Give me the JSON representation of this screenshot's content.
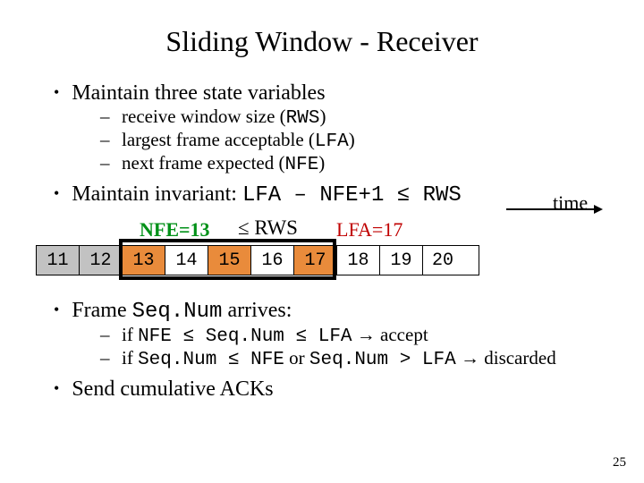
{
  "title": "Sliding Window - Receiver",
  "b1": "Maintain three state variables",
  "s1a_pre": "receive window size (",
  "s1a_code": "RWS",
  "s1a_post": ")",
  "s1b_pre": "largest frame acceptable (",
  "s1b_code": "LFA",
  "s1b_post": ")",
  "s1c_pre": "next frame expected (",
  "s1c_code": "NFE",
  "s1c_post": ")",
  "b2_pre": "Maintain invariant: ",
  "b2_code": "LFA – NFE+1 ≤ RWS",
  "diag": {
    "nfe": "NFE=13",
    "rws": "≤ RWS",
    "lfa": "LFA=17",
    "time": "time",
    "cells": [
      "11",
      "12",
      "13",
      "14",
      "15",
      "16",
      "17",
      "18",
      "19",
      "20"
    ]
  },
  "b3_pre": "Frame ",
  "b3_code": "Seq.Num",
  "b3_post": " arrives:",
  "s3a_pre": "if ",
  "s3a_code": "NFE ≤ Seq.Num ≤ LFA",
  "s3a_arrow": " → ",
  "s3a_post": "accept",
  "s3b_pre": "if ",
  "s3b_code1": "Seq.Num ≤ NFE",
  "s3b_or": " or ",
  "s3b_code2": "Seq.Num > LFA",
  "s3b_arrow": " → ",
  "s3b_post": "discarded",
  "b4": "Send cumulative ACKs",
  "page": "25"
}
